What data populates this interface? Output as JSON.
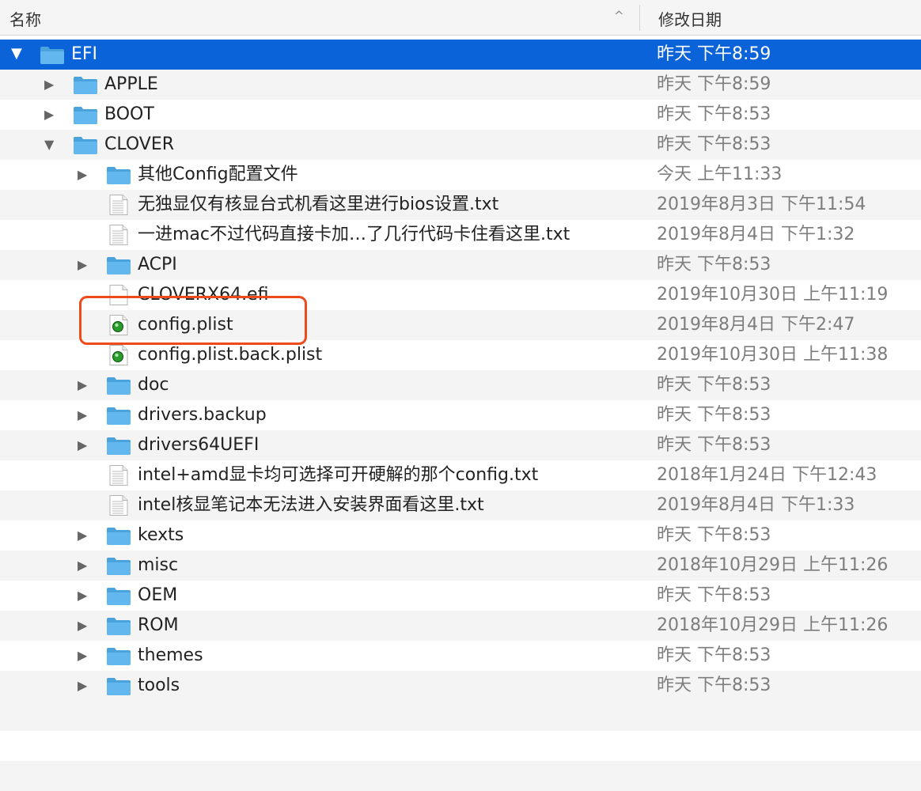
{
  "header": {
    "name_label": "名称",
    "date_label": "修改日期",
    "sort_indicator": "^"
  },
  "rows": [
    {
      "name": "EFI",
      "date": "昨天 下午8:59",
      "type": "folder",
      "level": 0,
      "disclosure": "expanded",
      "selected": true
    },
    {
      "name": "APPLE",
      "date": "昨天 下午8:59",
      "type": "folder",
      "level": 1,
      "disclosure": "collapsed"
    },
    {
      "name": "BOOT",
      "date": "昨天 下午8:53",
      "type": "folder",
      "level": 1,
      "disclosure": "collapsed"
    },
    {
      "name": "CLOVER",
      "date": "昨天 下午8:53",
      "type": "folder",
      "level": 1,
      "disclosure": "expanded"
    },
    {
      "name": "其他Config配置文件",
      "date": "今天 上午11:33",
      "type": "folder",
      "level": 2,
      "disclosure": "collapsed"
    },
    {
      "name": "无独显仅有核显台式机看这里进行bios设置.txt",
      "date": "2019年8月3日 下午11:54",
      "type": "text",
      "level": 2,
      "disclosure": "none"
    },
    {
      "name": "一进mac不过代码直接卡加…了几行代码卡住看这里.txt",
      "date": "2019年8月4日 下午1:32",
      "type": "text",
      "level": 2,
      "disclosure": "none"
    },
    {
      "name": "ACPI",
      "date": "昨天 下午8:53",
      "type": "folder",
      "level": 2,
      "disclosure": "collapsed"
    },
    {
      "name": "CLOVERX64.efi",
      "date": "2019年10月30日 上午11:19",
      "type": "file",
      "level": 2,
      "disclosure": "none"
    },
    {
      "name": "config.plist",
      "date": "2019年8月4日 下午2:47",
      "type": "plist",
      "level": 2,
      "disclosure": "none"
    },
    {
      "name": "config.plist.back.plist",
      "date": "2019年10月30日 上午11:38",
      "type": "plist",
      "level": 2,
      "disclosure": "none"
    },
    {
      "name": "doc",
      "date": "昨天 下午8:53",
      "type": "folder",
      "level": 2,
      "disclosure": "collapsed"
    },
    {
      "name": "drivers.backup",
      "date": "昨天 下午8:53",
      "type": "folder",
      "level": 2,
      "disclosure": "collapsed"
    },
    {
      "name": "drivers64UEFI",
      "date": "昨天 下午8:53",
      "type": "folder",
      "level": 2,
      "disclosure": "collapsed"
    },
    {
      "name": "intel+amd显卡均可选择可开硬解的那个config.txt",
      "date": "2018年1月24日 下午12:43",
      "type": "text",
      "level": 2,
      "disclosure": "none"
    },
    {
      "name": "intel核显笔记本无法进入安装界面看这里.txt",
      "date": "2019年8月4日 下午1:33",
      "type": "text",
      "level": 2,
      "disclosure": "none"
    },
    {
      "name": "kexts",
      "date": "昨天 下午8:53",
      "type": "folder",
      "level": 2,
      "disclosure": "collapsed"
    },
    {
      "name": "misc",
      "date": "2018年10月29日 上午11:26",
      "type": "folder",
      "level": 2,
      "disclosure": "collapsed"
    },
    {
      "name": "OEM",
      "date": "昨天 下午8:53",
      "type": "folder",
      "level": 2,
      "disclosure": "collapsed"
    },
    {
      "name": "ROM",
      "date": "2018年10月29日 上午11:26",
      "type": "folder",
      "level": 2,
      "disclosure": "collapsed"
    },
    {
      "name": "themes",
      "date": "昨天 下午8:53",
      "type": "folder",
      "level": 2,
      "disclosure": "collapsed"
    },
    {
      "name": "tools",
      "date": "昨天 下午8:53",
      "type": "folder",
      "level": 2,
      "disclosure": "collapsed"
    }
  ],
  "colors": {
    "selection": "#0a63d8",
    "folder": "#62b8ee",
    "folder_dark": "#4aa3dd",
    "highlight": "#ee4a1c",
    "alt_row": "#f4f4f4"
  }
}
